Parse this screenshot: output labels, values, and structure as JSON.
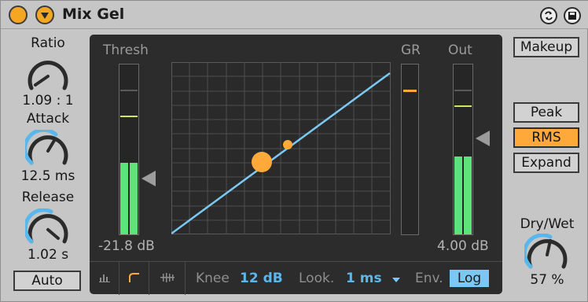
{
  "device": {
    "title": "Mix Gel"
  },
  "left": {
    "ratio": {
      "label": "Ratio",
      "value": "1.09 : 1"
    },
    "attack": {
      "label": "Attack",
      "value": "12.5 ms"
    },
    "release": {
      "label": "Release",
      "value": "1.02 s"
    },
    "auto_label": "Auto"
  },
  "display": {
    "thresh_label": "Thresh",
    "gr_label": "GR",
    "out_label": "Out",
    "thresh_value": "-21.8 dB",
    "out_value": "4.00 dB",
    "thresh_meter_level": 0.42,
    "out_meter_level": 0.46
  },
  "strip": {
    "knee_label": "Knee",
    "knee_value": "12 dB",
    "look_label": "Look.",
    "look_value": "1 ms",
    "env_label": "Env.",
    "env_value": "Log"
  },
  "right": {
    "makeup_label": "Makeup",
    "peak_label": "Peak",
    "rms_label": "RMS",
    "expand_label": "Expand",
    "drywet_label": "Dry/Wet",
    "drywet_value": "57 %"
  },
  "colors": {
    "accent": "#ffa93a",
    "meter": "#5ee37a",
    "curve": "#7bc9f2"
  }
}
